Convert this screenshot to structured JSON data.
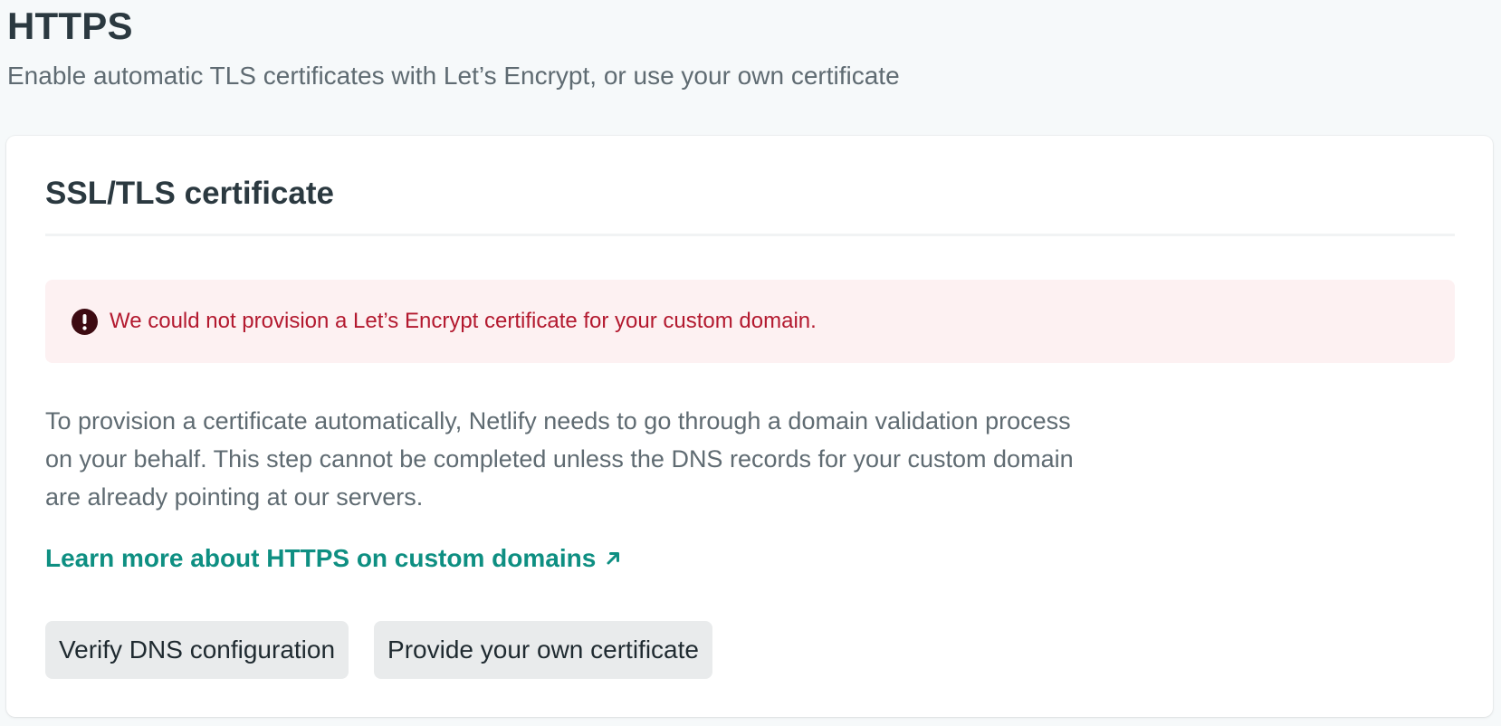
{
  "header": {
    "title": "HTTPS",
    "subtitle": "Enable automatic TLS certificates with Let’s Encrypt, or use your own certificate"
  },
  "card": {
    "title": "SSL/TLS certificate",
    "alert": {
      "icon": "exclamation-circle-icon",
      "text": "We could not provision a Let’s Encrypt certificate for your custom domain."
    },
    "description": "To provision a certificate automatically, Netlify needs to go through a domain validation process on your behalf. This step cannot be completed unless the DNS records for your custom domain are already pointing at our servers.",
    "learn_link": {
      "label": "Learn more about HTTPS on custom domains",
      "icon": "external-arrow-icon"
    },
    "buttons": {
      "verify_dns": "Verify DNS configuration",
      "own_certificate": "Provide your own certificate"
    }
  },
  "colors": {
    "background": "#f6f9fa",
    "card": "#ffffff",
    "alert_background": "#fdf1f2",
    "alert_text": "#b3192f",
    "link": "#0e8f82",
    "button_background": "#e9ebec"
  }
}
